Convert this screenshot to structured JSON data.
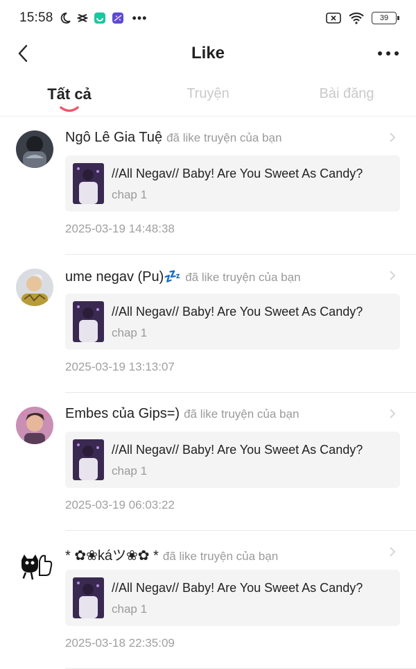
{
  "status_bar": {
    "time": "15:58",
    "battery": "39"
  },
  "header": {
    "title": "Like"
  },
  "tabs": [
    {
      "label": "Tất cả",
      "active": true
    },
    {
      "label": "Truyện",
      "active": false
    },
    {
      "label": "Bài đăng",
      "active": false
    }
  ],
  "notifications": [
    {
      "username": "Ngô Lê Gia Tuệ",
      "action": "đã like truyện của bạn",
      "story_title": "//All Negav// Baby! Are You Sweet As Candy?",
      "chapter": "chap 1",
      "timestamp": "2025-03-19 14:48:38"
    },
    {
      "username": "ume negav (Pu)💤",
      "action": "đã like truyện của bạn",
      "story_title": "//All Negav// Baby! Are You Sweet As Candy?",
      "chapter": "chap 1",
      "timestamp": "2025-03-19 13:13:07"
    },
    {
      "username": "Embes của Gips=)",
      "action": "đã like truyện của bạn",
      "story_title": "//All Negav// Baby! Are You Sweet As Candy?",
      "chapter": "chap 1",
      "timestamp": "2025-03-19 06:03:22"
    },
    {
      "username": "* ✿❀káツ❀✿ *",
      "action": "đã like truyện của bạn",
      "story_title": "//All Negav// Baby! Are You Sweet As Candy?",
      "chapter": "chap 1",
      "timestamp": "2025-03-18 22:35:09"
    }
  ],
  "colors": {
    "accent": "#f0566e",
    "muted": "#9a9a9a",
    "card_bg": "#f4f4f4"
  }
}
